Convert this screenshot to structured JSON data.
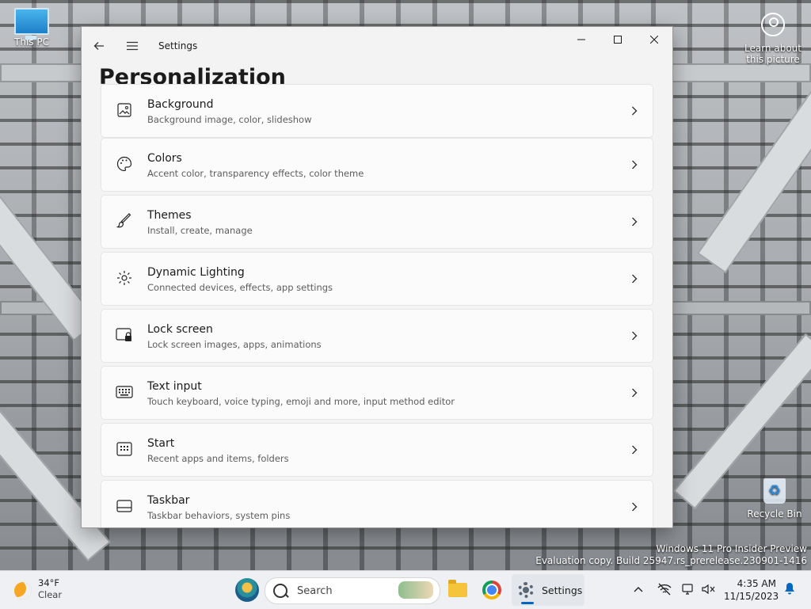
{
  "desktop": {
    "this_pc_label": "This PC",
    "recycle_bin_label": "Recycle Bin",
    "learn_label_line1": "Learn about",
    "learn_label_line2": "this picture",
    "watermark_line1": "Windows 11 Pro Insider Preview",
    "watermark_line2": "Evaluation copy. Build 25947.rs_prerelease.230901-1416"
  },
  "window": {
    "app_title": "Settings",
    "page_title": "Personalization",
    "controls": {
      "minimize": "—",
      "maximize": "☐",
      "close": "✕"
    }
  },
  "items": [
    {
      "title": "Background",
      "subtitle": "Background image, color, slideshow",
      "icon": "image-icon"
    },
    {
      "title": "Colors",
      "subtitle": "Accent color, transparency effects, color theme",
      "icon": "palette-icon"
    },
    {
      "title": "Themes",
      "subtitle": "Install, create, manage",
      "icon": "brush-icon"
    },
    {
      "title": "Dynamic Lighting",
      "subtitle": "Connected devices, effects, app settings",
      "icon": "lighting-icon"
    },
    {
      "title": "Lock screen",
      "subtitle": "Lock screen images, apps, animations",
      "icon": "lock-screen-icon"
    },
    {
      "title": "Text input",
      "subtitle": "Touch keyboard, voice typing, emoji and more, input method editor",
      "icon": "keyboard-icon"
    },
    {
      "title": "Start",
      "subtitle": "Recent apps and items, folders",
      "icon": "start-icon"
    },
    {
      "title": "Taskbar",
      "subtitle": "Taskbar behaviors, system pins",
      "icon": "taskbar-icon"
    }
  ],
  "taskbar": {
    "weather_temp": "34°F",
    "weather_cond": "Clear",
    "search_label": "Search",
    "settings_label": "Settings",
    "time": "4:35 AM",
    "date": "11/15/2023"
  },
  "colors": {
    "accent": "#0067c0",
    "window_bg": "#f3f3f3",
    "card_bg": "#fbfbfb"
  }
}
